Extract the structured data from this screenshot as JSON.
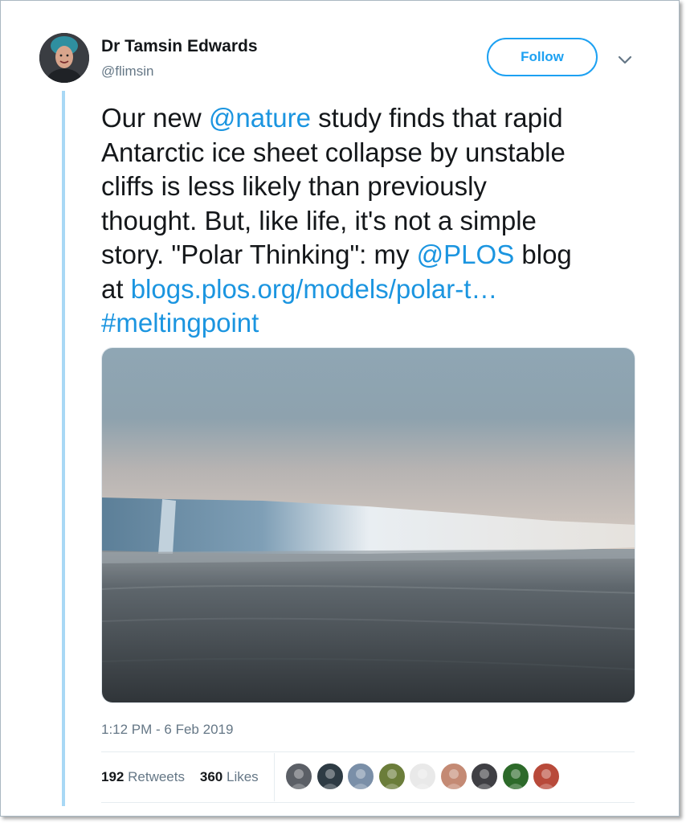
{
  "tweet": {
    "author": {
      "display_name": "Dr Tamsin Edwards",
      "handle": "@flimsin"
    },
    "follow_label": "Follow",
    "text_lines": [
      [
        {
          "t": "Our new "
        },
        {
          "t": "@nature",
          "link": true
        },
        {
          "t": " study finds that rapid"
        }
      ],
      [
        {
          "t": "Antarctic ice sheet collapse by unstable"
        }
      ],
      [
        {
          "t": "cliffs is less likely than previously"
        }
      ],
      [
        {
          "t": "thought. But, like life, it's not a simple"
        }
      ],
      [
        {
          "t": "story. \"Polar Thinking\": my "
        },
        {
          "t": "@PLOS",
          "link": true
        },
        {
          "t": " blog"
        }
      ],
      [
        {
          "t": "at "
        },
        {
          "t": "blogs.plos.org/models/polar-t…",
          "link": true
        }
      ],
      [
        {
          "t": "#meltingpoint",
          "link": true
        }
      ]
    ],
    "timestamp": "1:12 PM - 6 Feb 2019",
    "stats": {
      "retweets_count": "192",
      "retweets_label": "Retweets",
      "likes_count": "360",
      "likes_label": "Likes"
    },
    "liker_avatars": [
      {
        "name": "liker-avatar-1",
        "color": "#5b5f66"
      },
      {
        "name": "liker-avatar-2",
        "color": "#2e3b44"
      },
      {
        "name": "liker-avatar-3",
        "color": "#7a8fa8"
      },
      {
        "name": "liker-avatar-4",
        "color": "#6b7d3a"
      },
      {
        "name": "liker-avatar-5",
        "color": "#e9e9e9"
      },
      {
        "name": "liker-avatar-6",
        "color": "#c48a74"
      },
      {
        "name": "liker-avatar-7",
        "color": "#3f3f44"
      },
      {
        "name": "liker-avatar-8",
        "color": "#2d6a2a"
      },
      {
        "name": "liker-avatar-9",
        "color": "#b84a3a"
      }
    ],
    "colors": {
      "link": "#1b95e0",
      "follow": "#1da1f2",
      "thread_line": "#a8d8f5"
    }
  }
}
